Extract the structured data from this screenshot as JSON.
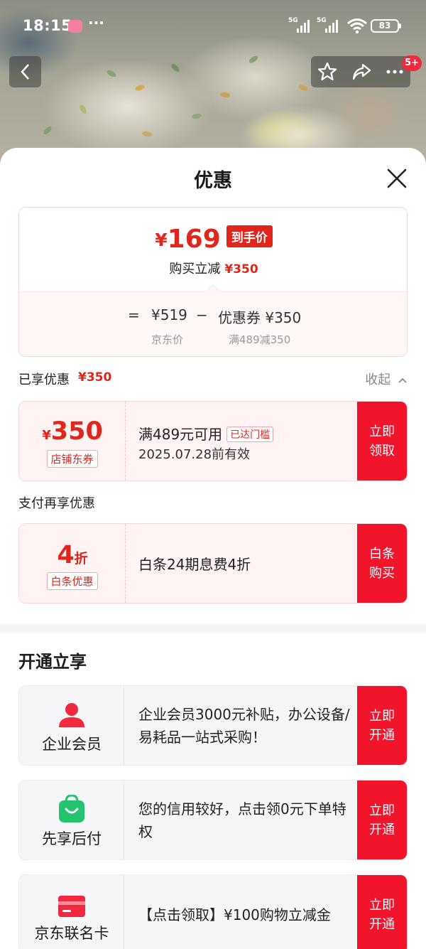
{
  "status_bar": {
    "time": "18:15",
    "dots": "···",
    "network1": "5G",
    "network2": "5G",
    "battery": "83"
  },
  "nav": {
    "message_count": "5+"
  },
  "sheet": {
    "title": "优惠"
  },
  "price_card": {
    "currency": "¥",
    "final_price": "169",
    "final_tag": "到手价",
    "saving_label": "购买立减",
    "saving_amount": "¥350",
    "equals": "=",
    "list_price": "¥519",
    "minus": "−",
    "coupon_value": "优惠券 ¥350",
    "list_price_label": "京东价",
    "coupon_rule": "满489减350"
  },
  "enjoyed": {
    "label": "已享优惠",
    "amount": "¥350",
    "collapse_label": "收起"
  },
  "store_coupon": {
    "currency": "¥",
    "amount": "350",
    "type": "店铺东券",
    "condition": "满489元可用",
    "condition_tag": "已达门槛",
    "validity": "2025.07.28前有效",
    "button": "立即\n领取"
  },
  "pay_section": {
    "label": "支付再享优惠"
  },
  "baitiao": {
    "amount": "4",
    "unit": "折",
    "type": "白条优惠",
    "desc": "白条24期息费4折",
    "button": "白条\n购买"
  },
  "open_section": {
    "title": "开通立享"
  },
  "members": [
    {
      "icon": "person-icon",
      "name": "企业会员",
      "desc": " 企业会员3000元补贴，办公设备/易耗品一站式采购！",
      "button": "立即\n开通",
      "color": "#f2283f"
    },
    {
      "icon": "shopping-bag-icon",
      "name": "先享后付",
      "desc": "您的信用较好，点击领0元下单特权",
      "button": "立即\n开通",
      "color": "#25c270"
    },
    {
      "icon": "credit-card-icon",
      "name": "京东联名卡",
      "desc": "【点击领取】¥100购物立减金",
      "button": "立即\n开通",
      "color": "#f2283f"
    }
  ]
}
